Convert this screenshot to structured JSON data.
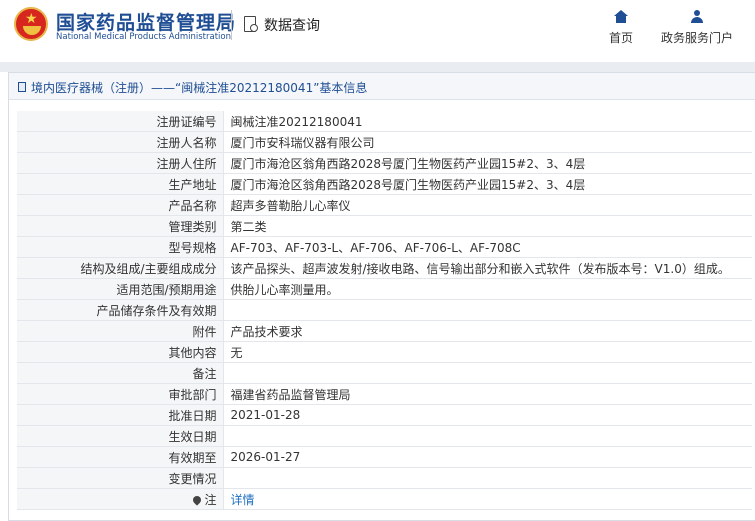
{
  "header": {
    "site_name_cn": "国家药品监督管理局",
    "site_name_en": "National Medical Products Administration",
    "query_label": "数据查询",
    "nav": [
      {
        "label": "首页",
        "icon": "home-icon"
      },
      {
        "label": "政务服务门户",
        "icon": "user-icon"
      }
    ]
  },
  "panel": {
    "title": "境内医疗器械（注册）——“闽械注准20212180041”基本信息"
  },
  "rows": [
    {
      "label": "注册证编号",
      "value": "闽械注准20212180041"
    },
    {
      "label": "注册人名称",
      "value": "厦门市安科瑞仪器有限公司"
    },
    {
      "label": "注册人住所",
      "value": "厦门市海沧区翁角西路2028号厦门生物医药产业园15#2、3、4层"
    },
    {
      "label": "生产地址",
      "value": "厦门市海沧区翁角西路2028号厦门生物医药产业园15#2、3、4层"
    },
    {
      "label": "产品名称",
      "value": "超声多普勒胎儿心率仪"
    },
    {
      "label": "管理类别",
      "value": "第二类"
    },
    {
      "label": "型号规格",
      "value": "AF-703、AF-703-L、AF-706、AF-706-L、AF-708C"
    },
    {
      "label": "结构及组成/主要组成成分",
      "value": "该产品探头、超声波发射/接收电路、信号输出部分和嵌入式软件（发布版本号：V1.0）组成。"
    },
    {
      "label": "适用范围/预期用途",
      "value": "供胎儿心率测量用。"
    },
    {
      "label": "产品储存条件及有效期",
      "value": ""
    },
    {
      "label": "附件",
      "value": "产品技术要求"
    },
    {
      "label": "其他内容",
      "value": "无"
    },
    {
      "label": "备注",
      "value": ""
    },
    {
      "label": "审批部门",
      "value": "福建省药品监督管理局"
    },
    {
      "label": "批准日期",
      "value": "2021-01-28"
    },
    {
      "label": "生效日期",
      "value": ""
    },
    {
      "label": "有效期至",
      "value": "2026-01-27"
    },
    {
      "label": "变更情况",
      "value": ""
    }
  ],
  "note_row": {
    "label": "注",
    "link": "详情"
  },
  "colors": {
    "brand_blue": "#1f4e94",
    "link_blue": "#1f6fc0",
    "logo_red": "#d7261e"
  }
}
